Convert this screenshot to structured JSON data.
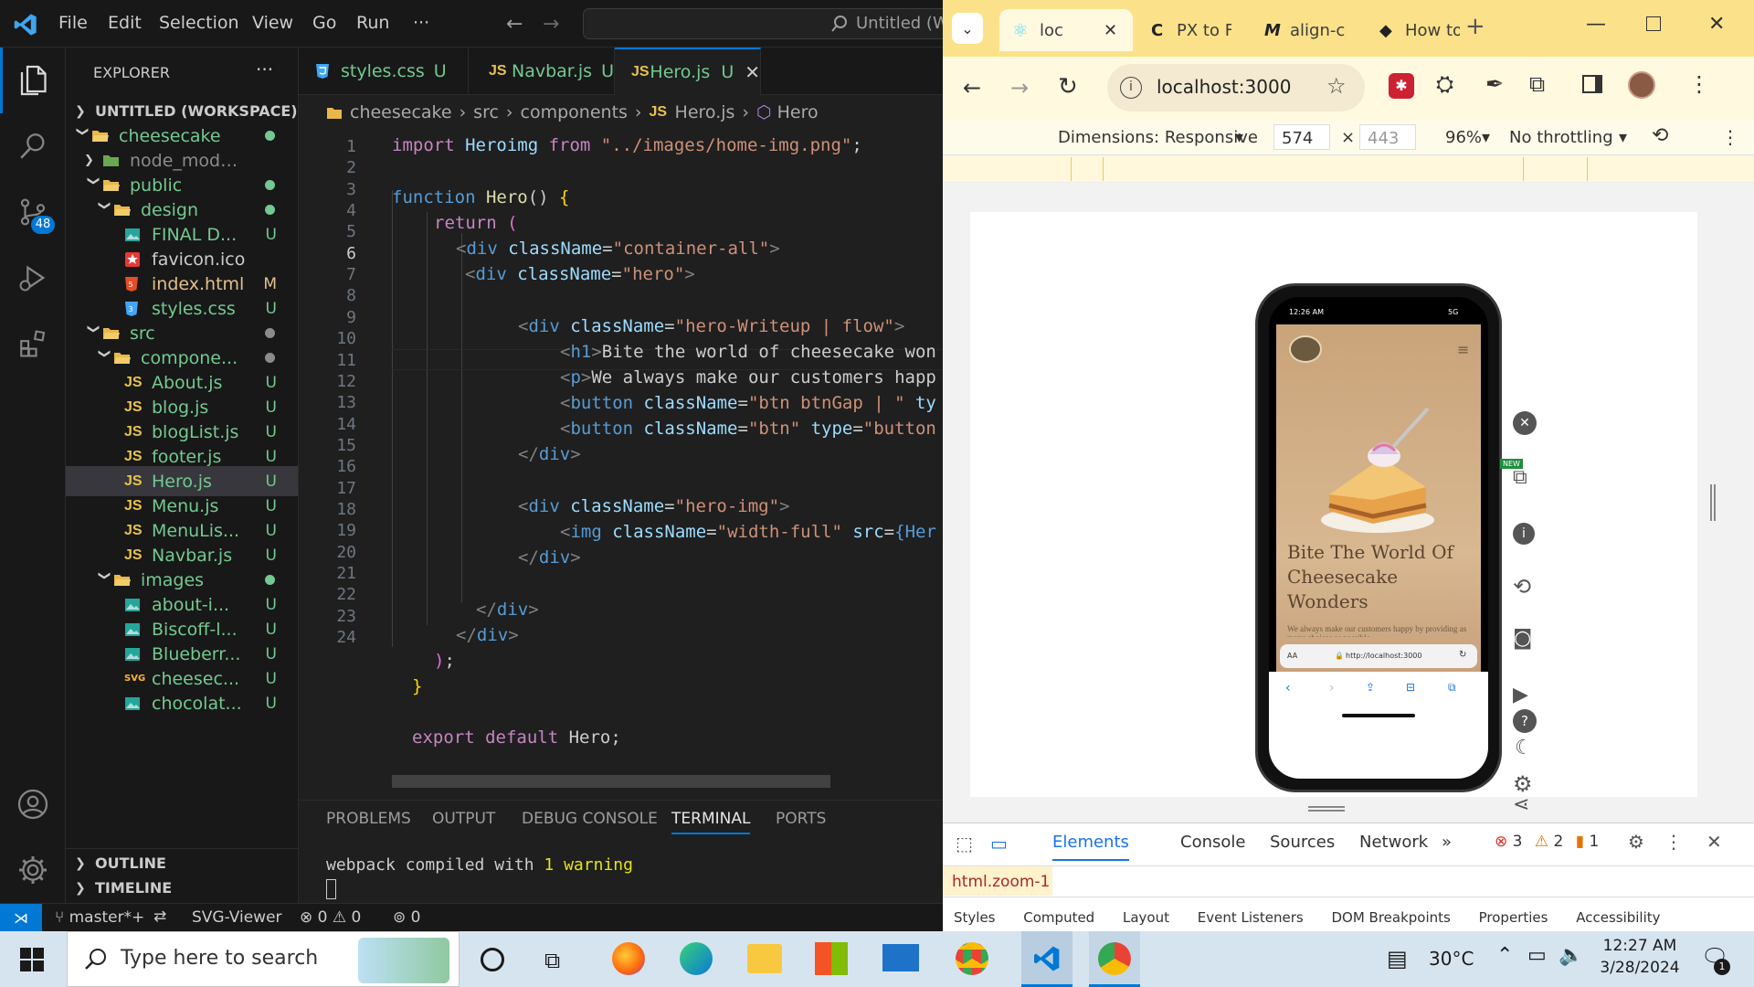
{
  "vscode": {
    "menu": [
      "File",
      "Edit",
      "Selection",
      "View",
      "Go",
      "Run",
      "···"
    ],
    "command_center": "Untitled (Workspace)",
    "explorer": {
      "title": "EXPLORER",
      "more": "···",
      "workspace": "UNTITLED (WORKSPACE)",
      "items": [
        {
          "name": "cheesecake",
          "status": "",
          "dot": "#73c991",
          "indent": 1,
          "kind": "folder-open",
          "color": "#73c991"
        },
        {
          "name": "node_modules",
          "status": "",
          "dot": "",
          "indent": 2,
          "kind": "folder-closed",
          "color": "#8b8b8b"
        },
        {
          "name": "public",
          "status": "",
          "dot": "#73c991",
          "indent": 2,
          "kind": "folder-open",
          "color": "#73c991"
        },
        {
          "name": "design",
          "status": "",
          "dot": "#73c991",
          "indent": 3,
          "kind": "folder-open",
          "color": "#73c991"
        },
        {
          "name": "FINAL D...",
          "status": "U",
          "dot": "",
          "indent": 4,
          "kind": "image",
          "color": "#73c991"
        },
        {
          "name": "favicon.ico",
          "status": "",
          "dot": "",
          "indent": 4,
          "kind": "favicon",
          "color": "#cccccc"
        },
        {
          "name": "index.html",
          "status": "M",
          "dot": "",
          "indent": 4,
          "kind": "html",
          "color": "#e2c08d"
        },
        {
          "name": "styles.css",
          "status": "U",
          "dot": "",
          "indent": 4,
          "kind": "css",
          "color": "#73c991"
        },
        {
          "name": "src",
          "status": "",
          "dot": "#8b8b8b",
          "indent": 2,
          "kind": "folder-open",
          "color": "#73c991"
        },
        {
          "name": "compone...",
          "status": "",
          "dot": "#8b8b8b",
          "indent": 3,
          "kind": "folder-open",
          "color": "#73c991"
        },
        {
          "name": "About.js",
          "status": "U",
          "dot": "",
          "indent": 4,
          "kind": "js",
          "color": "#73c991"
        },
        {
          "name": "blog.js",
          "status": "U",
          "dot": "",
          "indent": 4,
          "kind": "js",
          "color": "#73c991"
        },
        {
          "name": "blogList.js",
          "status": "U",
          "dot": "",
          "indent": 4,
          "kind": "js",
          "color": "#73c991"
        },
        {
          "name": "footer.js",
          "status": "U",
          "dot": "",
          "indent": 4,
          "kind": "js",
          "color": "#73c991"
        },
        {
          "name": "Hero.js",
          "status": "U",
          "dot": "",
          "indent": 4,
          "kind": "js",
          "color": "#73c991",
          "selected": true
        },
        {
          "name": "Menu.js",
          "status": "U",
          "dot": "",
          "indent": 4,
          "kind": "js",
          "color": "#73c991"
        },
        {
          "name": "MenuLis...",
          "status": "U",
          "dot": "",
          "indent": 4,
          "kind": "js",
          "color": "#73c991"
        },
        {
          "name": "Navbar.js",
          "status": "U",
          "dot": "",
          "indent": 4,
          "kind": "js",
          "color": "#73c991"
        },
        {
          "name": "images",
          "status": "",
          "dot": "#73c991",
          "indent": 3,
          "kind": "folder-open",
          "color": "#73c991"
        },
        {
          "name": "about-i...",
          "status": "U",
          "dot": "",
          "indent": 4,
          "kind": "image",
          "color": "#73c991"
        },
        {
          "name": "Biscoff-l...",
          "status": "U",
          "dot": "",
          "indent": 4,
          "kind": "image",
          "color": "#73c991"
        },
        {
          "name": "Blueberr...",
          "status": "U",
          "dot": "",
          "indent": 4,
          "kind": "image",
          "color": "#73c991"
        },
        {
          "name": "cheesec...",
          "status": "U",
          "dot": "",
          "indent": 4,
          "kind": "svg",
          "color": "#73c991"
        },
        {
          "name": "chocolat...",
          "status": "U",
          "dot": "",
          "indent": 4,
          "kind": "image",
          "color": "#73c991"
        }
      ],
      "outline": "OUTLINE",
      "timeline": "TIMELINE"
    },
    "tabs": [
      {
        "icon": "css",
        "name": "styles.css",
        "status": "U"
      },
      {
        "icon": "js",
        "name": "Navbar.js",
        "status": "U"
      },
      {
        "icon": "js",
        "name": "Hero.js",
        "status": "U",
        "active": true
      }
    ],
    "breadcrumb": [
      "cheesecake",
      "src",
      "components",
      "Hero.js",
      "Hero"
    ],
    "line_numbers": [
      "1",
      "2",
      "3",
      "4",
      "5",
      "6",
      "7",
      "8",
      "9",
      "10",
      "11",
      "12",
      "13",
      "14",
      "15",
      "16",
      "17",
      "18",
      "19",
      "20",
      "21",
      "22",
      "23",
      "24"
    ],
    "code": {
      "l1": [
        "import ",
        "Heroimg",
        " from ",
        "\"../images/home-img.png\"",
        ";"
      ],
      "l3": [
        "function ",
        "Hero",
        "() ",
        "{"
      ],
      "l4": [
        "return ",
        "("
      ],
      "l5": [
        "<",
        "div",
        " className",
        "=",
        "\"container-all\"",
        ">"
      ],
      "l6": [
        "<",
        "div",
        " className",
        "=",
        "\"hero\"",
        ">"
      ],
      "l8": [
        "<",
        "div",
        " className",
        "=",
        "\"hero-Writeup | flow\"",
        ">"
      ],
      "l9": [
        "<",
        "h1",
        ">",
        "Bite the world of cheesecake won"
      ],
      "l10": [
        "<",
        "p",
        ">",
        "We always make our customers happ"
      ],
      "l11": [
        "<",
        "button",
        " className",
        "=",
        "\"btn btnGap | \"",
        " ty"
      ],
      "l12": [
        "<",
        "button",
        " className",
        "=",
        "\"btn\"",
        " type",
        "=",
        "\"button"
      ],
      "l13": [
        "</",
        "div",
        ">"
      ],
      "l15": [
        "<",
        "div",
        " className",
        "=",
        "\"hero-img\"",
        ">"
      ],
      "l16": [
        "<",
        "img",
        " className",
        "=",
        "\"width-full\"",
        " src",
        "=",
        "{Her"
      ],
      "l17": [
        "</",
        "div",
        ">"
      ],
      "l19": [
        "</",
        "div",
        ">"
      ],
      "l20": [
        "</",
        "div",
        ">"
      ],
      "l21": [
        ")",
        ";"
      ],
      "l22": [
        "}"
      ],
      "l24": [
        "export ",
        "default ",
        "Hero",
        ";"
      ]
    },
    "panel": {
      "tabs": [
        "PROBLEMS",
        "OUTPUT",
        "DEBUG CONSOLE",
        "TERMINAL",
        "PORTS"
      ],
      "active": "TERMINAL",
      "terminal": [
        "webpack compiled with ",
        "1 warning"
      ]
    },
    "statusbar": {
      "branch": "master*+",
      "svg_viewer": "SVG-Viewer",
      "errors": "0",
      "warnings": "0",
      "ports": "0"
    },
    "scm_badge": "48"
  },
  "chrome": {
    "tabs": [
      {
        "title": "loc",
        "icon": "react"
      },
      {
        "title": "PX to F",
        "icon": "c"
      },
      {
        "title": "align-c",
        "icon": "m"
      },
      {
        "title": "How to",
        "icon": "how"
      }
    ],
    "url": "localhost:3000",
    "device_toolbar": {
      "dimensions": "Dimensions: Responsive",
      "width": "574",
      "height": "443",
      "times": "×",
      "zoom": "96%",
      "throttle": "No throttling"
    },
    "phone": {
      "time": "12:26 AM",
      "signal": "5G",
      "heading": "Bite The World Of Cheesecake Wonders",
      "subtext": "We always make our customers happy by providing as many choices as possible",
      "url": "http://localhost:3000",
      "aa": "AA"
    },
    "side_badge": "NEW",
    "devtools": {
      "tabs": [
        "Elements",
        "Console",
        "Sources",
        "Network"
      ],
      "active": "Elements",
      "more": "»",
      "errors": "3",
      "warnings": "2",
      "issues": "1",
      "selected_node": "html.zoom-1",
      "subtabs": [
        "Styles",
        "Computed",
        "Layout",
        "Event Listeners",
        "DOM Breakpoints",
        "Properties",
        "Accessibility"
      ]
    }
  },
  "taskbar": {
    "search_placeholder": "Type here to search",
    "temperature": "30°C",
    "time": "12:27 AM",
    "date": "3/28/2024",
    "notification_count": "1"
  }
}
